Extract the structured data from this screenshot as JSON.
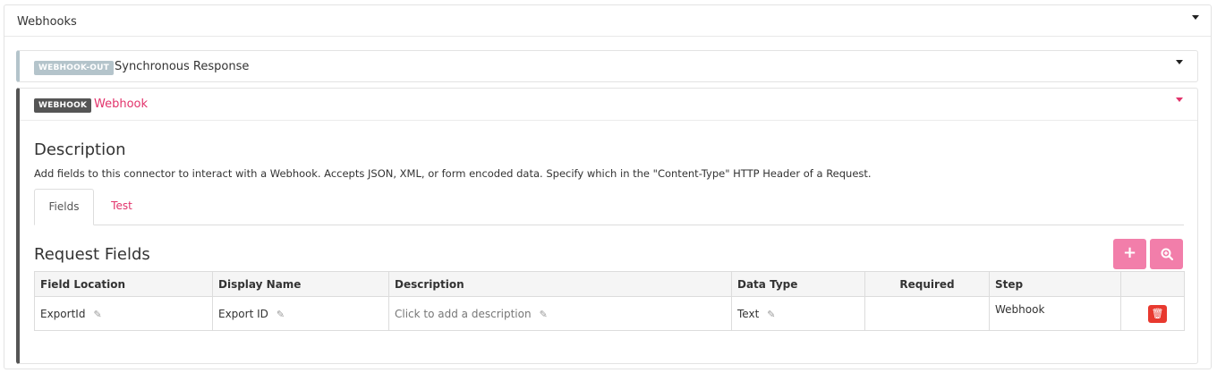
{
  "outer": {
    "title": "Webhooks"
  },
  "sync_panel": {
    "badge": "WEBHOOK-OUT",
    "title": "Synchronous Response"
  },
  "webhook_panel": {
    "badge": "WEBHOOK",
    "title": "Webhook",
    "description_heading": "Description",
    "description_text": "Add fields to this connector to interact with a Webhook. Accepts JSON, XML, or form encoded data. Specify which in the \"Content-Type\" HTTP Header of a Request.",
    "tabs": [
      {
        "label": "Fields",
        "active": true
      },
      {
        "label": "Test",
        "active": false
      }
    ],
    "request_fields": {
      "heading": "Request Fields",
      "add_icon": "plus-icon",
      "inspect_icon": "magnify-plus-icon",
      "columns": [
        "Field Location",
        "Display Name",
        "Description",
        "Data Type",
        "Required",
        "Step",
        ""
      ],
      "rows": [
        {
          "field_location": "ExportId",
          "display_name": "Export ID",
          "description": "Click to add a description",
          "data_type": "Text",
          "required": "",
          "step": "Webhook"
        }
      ]
    }
  },
  "colors": {
    "accent": "#e2336b",
    "button_pink": "#f27eaa",
    "delete_red": "#e8392f",
    "badge_dark": "#555555",
    "badge_light": "#b4c4cb"
  }
}
